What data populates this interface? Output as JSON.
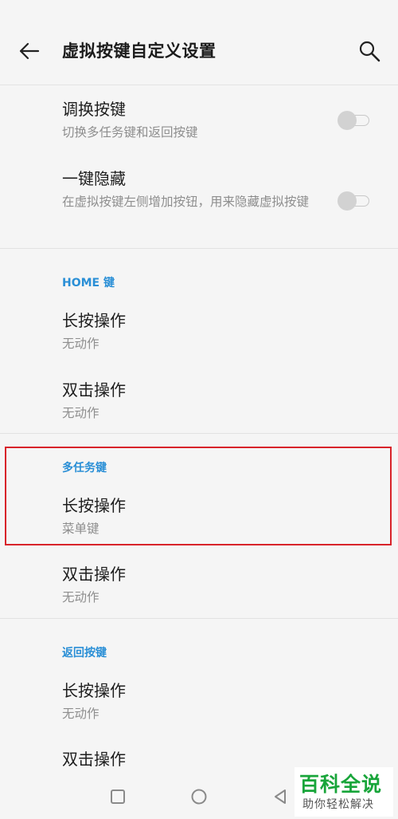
{
  "appbar": {
    "title": "虚拟按键自定义设置",
    "back_icon": "arrow-left-icon",
    "search_icon": "search-icon"
  },
  "toggles": {
    "swap_keys": {
      "title": "调换按键",
      "subtitle": "切换多任务键和返回按键",
      "enabled": false
    },
    "one_key_hide": {
      "title": "一键隐藏",
      "subtitle": "在虚拟按键左侧增加按钮，用来隐藏虚拟按键",
      "enabled": false
    }
  },
  "sections": [
    {
      "header": "HOME 键",
      "items": [
        {
          "title": "长按操作",
          "subtitle": "无动作"
        },
        {
          "title": "双击操作",
          "subtitle": "无动作"
        }
      ]
    },
    {
      "header": "多任务键",
      "items": [
        {
          "title": "长按操作",
          "subtitle": "菜单键"
        },
        {
          "title": "双击操作",
          "subtitle": "无动作"
        }
      ]
    },
    {
      "header": "返回按键",
      "items": [
        {
          "title": "长按操作",
          "subtitle": "无动作"
        },
        {
          "title": "双击操作",
          "subtitle": ""
        }
      ]
    }
  ],
  "navbar": {
    "recents_icon": "square-icon",
    "home_icon": "circle-icon",
    "back_icon": "triangle-back-icon"
  },
  "watermark": {
    "title": "百科全说",
    "subtitle": "助你轻松解决"
  },
  "colors": {
    "accent": "#2a8fd6",
    "highlight": "#d8232a",
    "watermark_green": "#18a53a",
    "background": "#f5f5f5"
  }
}
